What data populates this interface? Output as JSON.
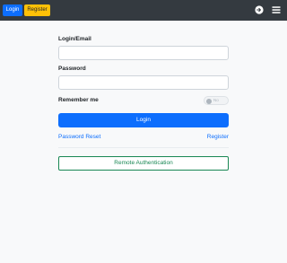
{
  "topbar": {
    "login_label": "Login",
    "register_label": "Register",
    "icons": [
      "sign-in-icon",
      "menu-icon"
    ],
    "colors": {
      "background": "#343a40",
      "login": "#0d6efd",
      "register": "#ffc107"
    }
  },
  "form": {
    "login_label": "Login/Email",
    "login_value": "",
    "password_label": "Password",
    "password_value": "",
    "remember_label": "Remember me",
    "remember_toggle_text": "No",
    "remember_checked": false,
    "submit_label": "Login",
    "password_reset_link": "Password Reset",
    "register_link": "Register",
    "remote_auth_label": "Remote Authentication",
    "colors": {
      "primary": "#0d6efd",
      "remote": "#198754"
    }
  }
}
